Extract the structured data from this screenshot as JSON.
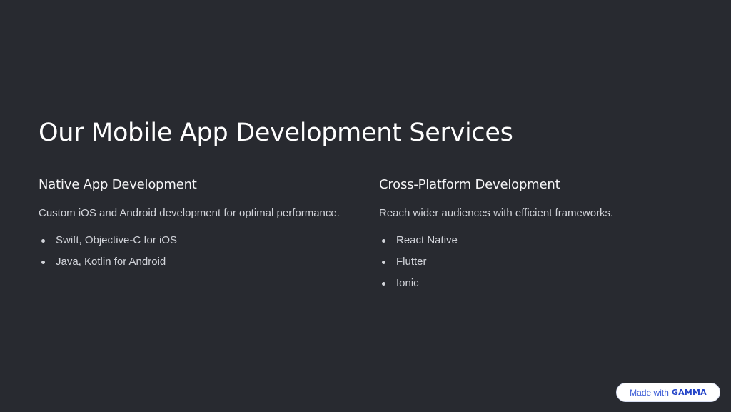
{
  "slide": {
    "title": "Our Mobile App Development Services",
    "columns": [
      {
        "heading": "Native App Development",
        "description": "Custom iOS and Android development for optimal performance.",
        "bullets": [
          "Swift, Objective-C for iOS",
          "Java, Kotlin for Android"
        ]
      },
      {
        "heading": "Cross-Platform Development",
        "description": "Reach wider audiences with efficient frameworks.",
        "bullets": [
          "React Native",
          "Flutter",
          "Ionic"
        ]
      }
    ]
  },
  "badge": {
    "made_with": "Made with",
    "brand": "GAMMA"
  },
  "colors": {
    "background": "#282a30",
    "title": "#ffffff",
    "body_text": "#d2d4da",
    "badge_accent": "#3b5bd6"
  }
}
